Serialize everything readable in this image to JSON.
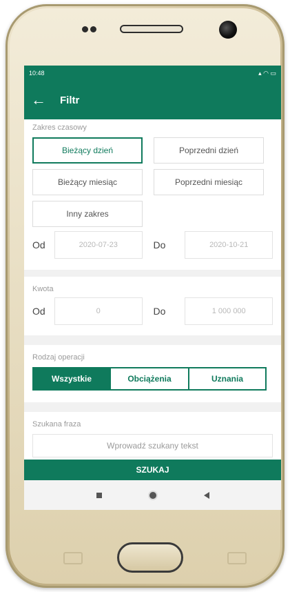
{
  "status": {
    "time": "10:48",
    "icons": "▴ ◠ ▭"
  },
  "appbar": {
    "back": "←",
    "title": "Filtr"
  },
  "time_range": {
    "label": "Zakres czasowy",
    "options": [
      "Bieżący dzień",
      "Poprzedni dzień",
      "Bieżący miesiąc",
      "Poprzedni miesiąc",
      "Inny zakres"
    ],
    "selected": "Bieżący dzień",
    "from_label": "Od",
    "from_value": "2020-07-23",
    "to_label": "Do",
    "to_value": "2020-10-21"
  },
  "amount": {
    "label": "Kwota",
    "from_label": "Od",
    "from_value": "0",
    "to_label": "Do",
    "to_value": "1 000 000"
  },
  "operation": {
    "label": "Rodzaj operacji",
    "options": [
      "Wszystkie",
      "Obciążenia",
      "Uznania"
    ],
    "selected": "Wszystkie"
  },
  "phrase": {
    "label": "Szukana fraza",
    "placeholder": "Wprowadź szukany tekst"
  },
  "search_button": "SZUKAJ",
  "colors": {
    "accent": "#0f7a5c"
  }
}
